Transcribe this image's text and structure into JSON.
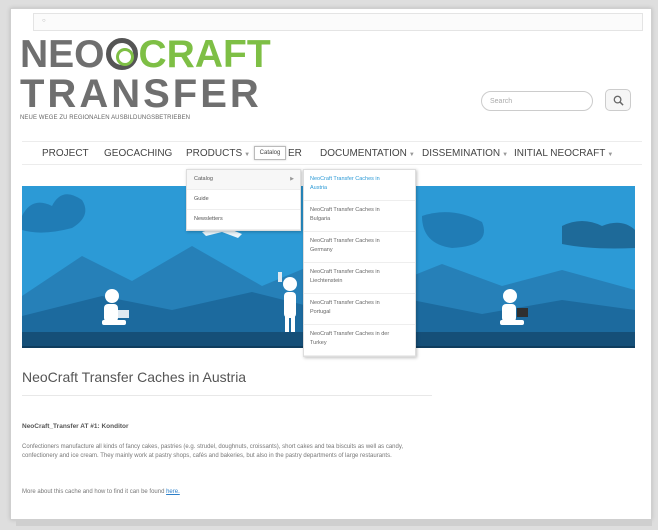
{
  "browser": {
    "address_text": ""
  },
  "logo": {
    "line1_part1": "NEO",
    "line1_part2": "CRAFT",
    "line2": "TRANSFER",
    "tagline": "NEUE WEGE ZU REGIONALEN AUSBILDUNGSBETRIEBEN"
  },
  "search": {
    "placeholder": "Search"
  },
  "nav": {
    "items": [
      {
        "label": "PROJECT",
        "has_caret": false
      },
      {
        "label": "GEOCACHING",
        "has_caret": false
      },
      {
        "label": "PRODUCTS",
        "has_caret": true
      },
      {
        "label": "ER",
        "has_caret": false
      },
      {
        "label": "DOCUMENTATION",
        "has_caret": true
      },
      {
        "label": "DISSEMINATION",
        "has_caret": true
      },
      {
        "label": "INITIAL NEOCRAFT",
        "has_caret": true
      }
    ],
    "tooltip": "Catalog"
  },
  "products_menu": {
    "items": [
      {
        "label": "Catalog",
        "has_submenu": true
      },
      {
        "label": "Guide",
        "has_submenu": false
      },
      {
        "label": "Newsletters",
        "has_submenu": false
      }
    ]
  },
  "catalog_submenu": {
    "items": [
      {
        "line1": "NeoCraft Transfer Caches in",
        "line2": "Austria"
      },
      {
        "line1": "NeoCraft Transfer Caches in",
        "line2": "Bulgaria"
      },
      {
        "line1": "NeoCraft Transfer Caches in",
        "line2": "Germany"
      },
      {
        "line1": "NeoCraft Transfer Caches in",
        "line2": "Liechtenstein"
      },
      {
        "line1": "NeoCraft Transfer Caches in",
        "line2": "Portugal"
      },
      {
        "line1": "NeoCraft Transfer Caches in der",
        "line2": "Turkey"
      }
    ]
  },
  "content": {
    "title": "NeoCraft Transfer Caches in Austria",
    "cache_heading": "NeoCraft_Transfer AT #1: Konditor",
    "description": "Confectioners manufacture all kinds of fancy cakes, pastries (e.g. strudel, doughnuts, croissants), short cakes and tea biscuits as well as candy, confectionery and ice cream. They mainly work at pastry shops, cafés and bakeries, but also in the pastry departments of large restaurants.",
    "more_prefix": "More about this cache and how to find it can be found ",
    "more_link": "here."
  },
  "colors": {
    "brand_green": "#7ebf45",
    "brand_gray": "#6f6f6f",
    "hero_blue": "#2c9ad6",
    "hero_dark": "#1b5e8a",
    "link_blue": "#2c7fc9"
  }
}
